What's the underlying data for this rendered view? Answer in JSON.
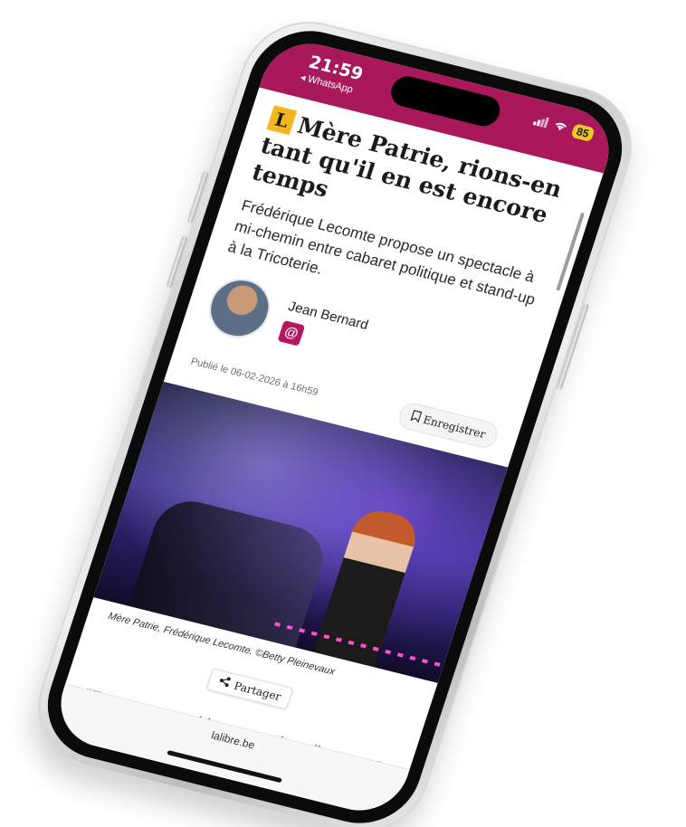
{
  "status_bar": {
    "time": "21:59",
    "back_app": "◂ WhatsApp",
    "battery": "85"
  },
  "article": {
    "brand_badge": "L",
    "title": "Mère Patrie, rions-en tant qu'il en est encore temps",
    "lead": "Frédérique Lecomte propose un spectacle à mi-chemin entre cabaret politique et stand-up à la Tricoterie.",
    "author_name": "Jean Bernard",
    "mail_icon": "@",
    "published": "Publié le 06-02-2026 à 16h59",
    "save_label": "Enregistrer",
    "photo_caption": "Mère Patrie, Frédérique Lecomte. ©Betty Pleinevaux",
    "share_label": "Partager",
    "quote": "\"Entrez, entrez, bienvenue, installez-vous\","
  },
  "browser": {
    "domain": "lalibre.be"
  },
  "colors": {
    "brand": "#a8185a",
    "badge": "#f3b61f",
    "mail": "#b4185e"
  },
  "icons": {
    "save": "bookmark-icon",
    "share": "share-icon",
    "signal": "signal-icon",
    "wifi": "wifi-icon"
  }
}
